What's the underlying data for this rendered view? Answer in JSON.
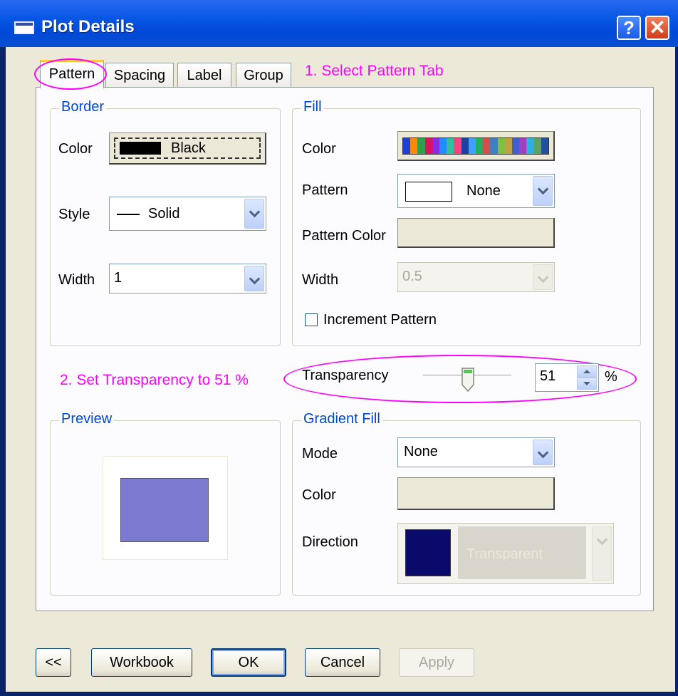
{
  "window": {
    "title": "Plot Details",
    "help_label": "?",
    "close_label": "✕"
  },
  "tabs": [
    "Pattern",
    "Spacing",
    "Label",
    "Group"
  ],
  "annotations": {
    "step1": "1. Select Pattern Tab",
    "step2": "2. Set Transparency to 51 %"
  },
  "border": {
    "title": "Border",
    "color_label": "Color",
    "color_value": "Black",
    "color_swatch": "#000000",
    "style_label": "Style",
    "style_value": "Solid",
    "width_label": "Width",
    "width_value": "1"
  },
  "fill": {
    "title": "Fill",
    "color_label": "Color",
    "color_swatches": [
      "#1f3fd8",
      "#ff8a00",
      "#2fa04a",
      "#e01060",
      "#8a2be2",
      "#1f8fff",
      "#30c0a0",
      "#ff4080",
      "#2040a0",
      "#40a0ff",
      "#20b060",
      "#d05050",
      "#4080c0",
      "#80c040",
      "#c0a040",
      "#4060d0",
      "#a040c0",
      "#30b0e0",
      "#60a060",
      "#2050a0"
    ],
    "pattern_label": "Pattern",
    "pattern_value": "None",
    "pattern_color_label": "Pattern Color",
    "width_label": "Width",
    "width_value": "0.5",
    "increment_label": "Increment Pattern",
    "increment_checked": false
  },
  "transparency": {
    "label": "Transparency",
    "value": "51",
    "unit": "%",
    "slider_fraction": 0.51
  },
  "preview": {
    "title": "Preview",
    "fill_color": "#7b79d0"
  },
  "gradient": {
    "title": "Gradient Fill",
    "mode_label": "Mode",
    "mode_value": "None",
    "color_label": "Color",
    "direction_label": "Direction",
    "direction_value": "Transparent",
    "direction_swatch": "#0a0a6a"
  },
  "buttons": {
    "back": "<<",
    "workbook": "Workbook",
    "ok": "OK",
    "cancel": "Cancel",
    "apply": "Apply"
  }
}
